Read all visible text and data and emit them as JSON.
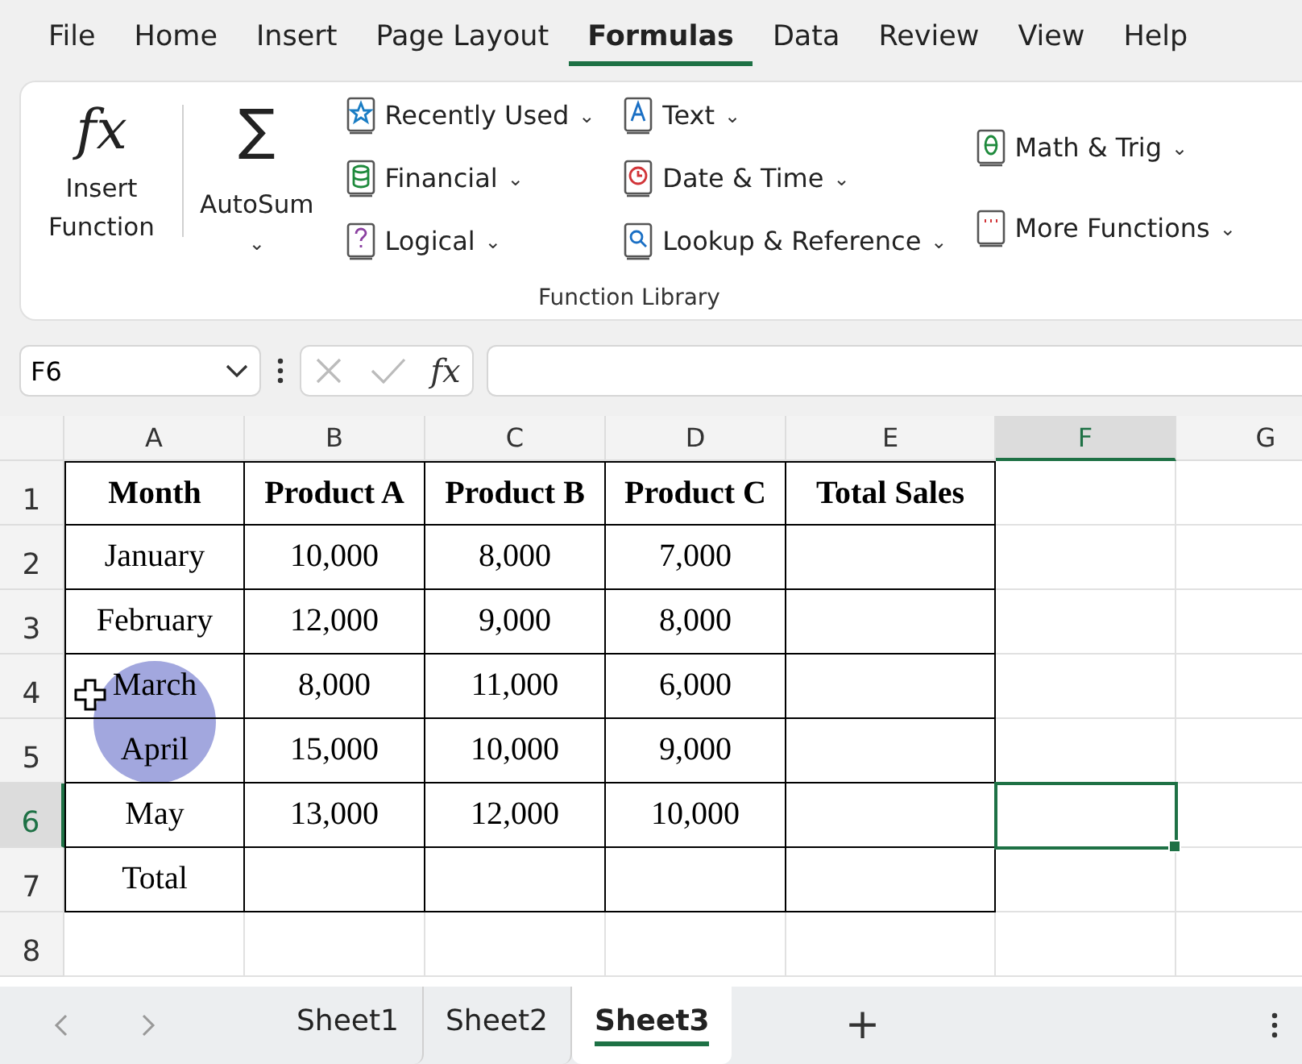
{
  "menu_tabs": [
    {
      "label": "File",
      "selected": false
    },
    {
      "label": "Home",
      "selected": false
    },
    {
      "label": "Insert",
      "selected": false
    },
    {
      "label": "Page Layout",
      "selected": false
    },
    {
      "label": "Formulas",
      "selected": true
    },
    {
      "label": "Data",
      "selected": false
    },
    {
      "label": "Review",
      "selected": false
    },
    {
      "label": "View",
      "selected": false
    },
    {
      "label": "Help",
      "selected": false
    }
  ],
  "ribbon": {
    "insert_function": {
      "glyph": "fx",
      "label": "Insert Function"
    },
    "autosum": {
      "glyph": "∑",
      "label": "AutoSum",
      "caret": "⌄"
    },
    "columns": [
      [
        {
          "label": "Recently Used",
          "caret": "⌄"
        },
        {
          "label": "Financial",
          "caret": "⌄"
        },
        {
          "label": "Logical",
          "caret": "⌄"
        }
      ],
      [
        {
          "label": "Text",
          "caret": "⌄"
        },
        {
          "label": "Date & Time",
          "caret": "⌄"
        },
        {
          "label": "Lookup & Reference",
          "caret": "⌄"
        }
      ],
      [
        {
          "label": "Math & Trig",
          "caret": "⌄"
        },
        {
          "label": "More Functions",
          "caret": "⌄"
        }
      ]
    ],
    "group_label": "Function Library"
  },
  "formula_bar": {
    "name_box": "F6",
    "fx": "fx"
  },
  "columns": [
    {
      "label": "A",
      "selected": false
    },
    {
      "label": "B",
      "selected": false
    },
    {
      "label": "C",
      "selected": false
    },
    {
      "label": "D",
      "selected": false
    },
    {
      "label": "E",
      "selected": false
    },
    {
      "label": "F",
      "selected": true
    },
    {
      "label": "G",
      "selected": false
    }
  ],
  "rows": [
    {
      "label": "1",
      "selected": false,
      "kind": "header",
      "cells": [
        "Month",
        "Product A",
        "Product B",
        "Product C",
        "Total Sales"
      ]
    },
    {
      "label": "2",
      "selected": false,
      "kind": "data",
      "cells": [
        "January",
        "10,000",
        "8,000",
        "7,000",
        null
      ]
    },
    {
      "label": "3",
      "selected": false,
      "kind": "data",
      "cells": [
        "February",
        "12,000",
        "9,000",
        "8,000",
        null
      ]
    },
    {
      "label": "4",
      "selected": false,
      "kind": "data",
      "cells": [
        "March",
        "8,000",
        "11,000",
        "6,000",
        null
      ]
    },
    {
      "label": "5",
      "selected": false,
      "kind": "data",
      "cells": [
        "April",
        "15,000",
        "10,000",
        "9,000",
        null
      ]
    },
    {
      "label": "6",
      "selected": true,
      "kind": "data",
      "cells": [
        "May",
        "13,000",
        "12,000",
        "10,000",
        null
      ]
    },
    {
      "label": "7",
      "selected": false,
      "kind": "data",
      "cells": [
        "Total",
        null,
        null,
        null,
        null
      ]
    },
    {
      "label": "8",
      "selected": false,
      "kind": "empty"
    }
  ],
  "sheets": [
    {
      "label": "Sheet1",
      "selected": false
    },
    {
      "label": "Sheet2",
      "selected": false
    },
    {
      "label": "Sheet3",
      "selected": true
    }
  ],
  "add_sheet": "+"
}
